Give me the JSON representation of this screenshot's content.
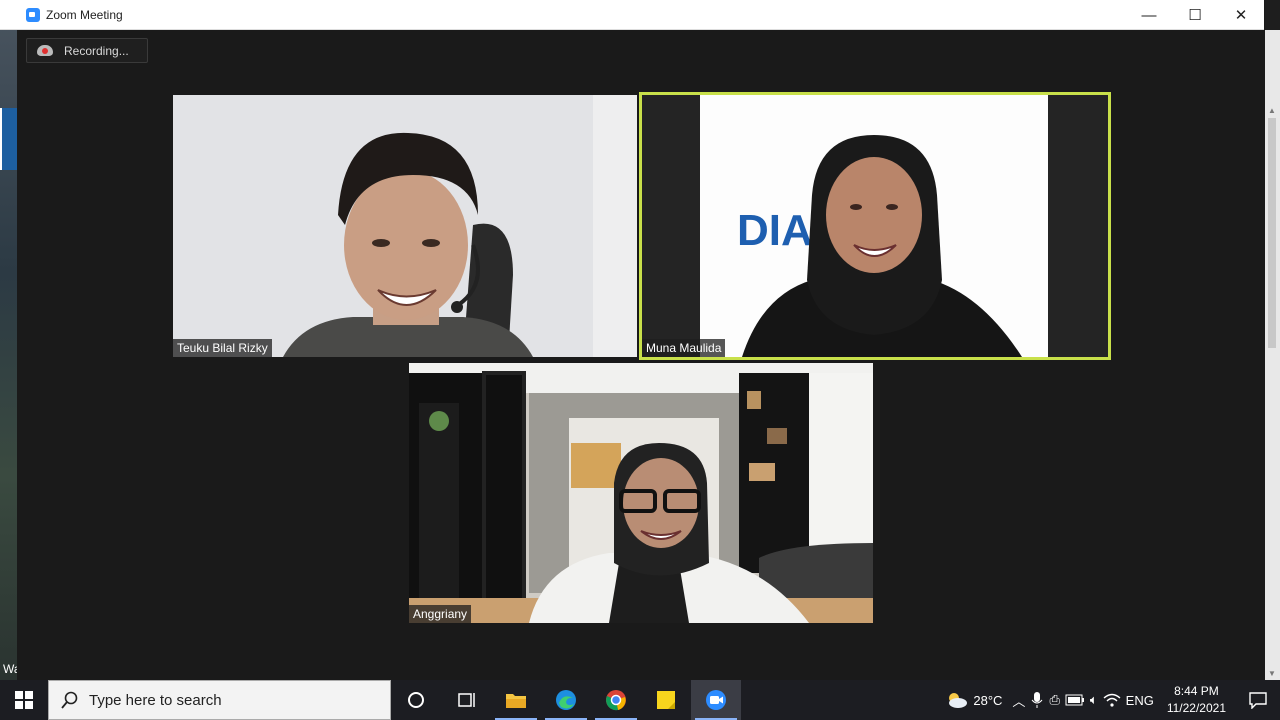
{
  "desktop": {
    "left_edge_text": "Wa"
  },
  "window": {
    "title": "Zoom Meeting",
    "minimize": "—",
    "maximize": "☐",
    "close": "✕"
  },
  "recording": {
    "label": "Recording..."
  },
  "participants": [
    {
      "name": "Teuku Bilal Rizky"
    },
    {
      "name": "Muna Maulida",
      "active_speaker": true,
      "highlight_color": "#c8e04a",
      "background_text": "DIA KA"
    },
    {
      "name": "Anggriany"
    }
  ],
  "taskbar": {
    "search_placeholder": "Type here to search",
    "apps": [
      "task-view",
      "file-explorer",
      "edge",
      "chrome",
      "sticky-notes",
      "zoom"
    ],
    "weather_temp": "28°C",
    "language": "ENG",
    "time": "8:44 PM",
    "date": "11/22/2021"
  }
}
